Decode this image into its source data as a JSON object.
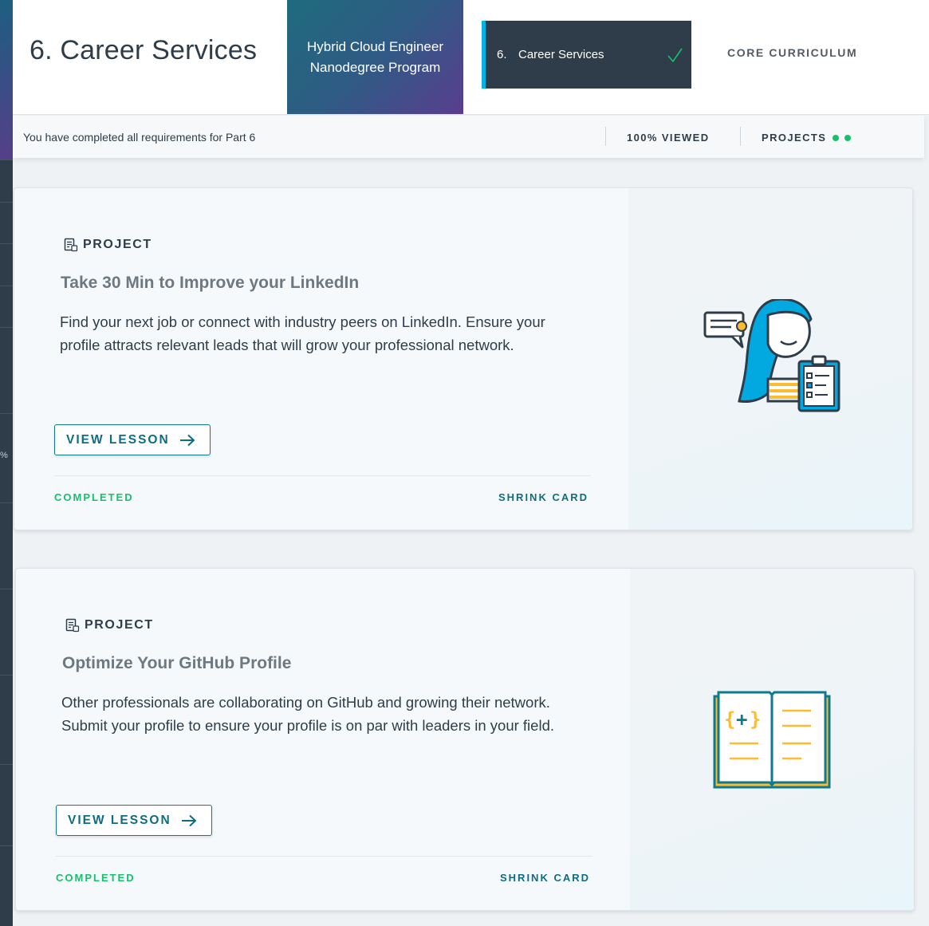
{
  "header": {
    "page_title": "6. Career Services",
    "program_name": "Hybrid Cloud Engineer Nanodegree Program",
    "current_part": {
      "number": "6.",
      "label": "Career Services",
      "completed": true
    },
    "core_curriculum_label": "CORE CURRICULUM"
  },
  "status": {
    "message": "You have completed all requirements for Part 6",
    "viewed": "100% VIEWED",
    "projects_label": "PROJECTS",
    "projects_dots": 2
  },
  "sidebar": {
    "partial_text": "%"
  },
  "cards": [
    {
      "kind": "PROJECT",
      "title": "Take 30 Min to Improve your LinkedIn",
      "description": "Find your next job or connect with industry peers on LinkedIn. Ensure your profile attracts relevant leads that will grow your professional network.",
      "button_label": "VIEW LESSON",
      "status": "COMPLETED",
      "toggle_label": "SHRINK CARD",
      "illustration": "person-with-clipboard-illustration"
    },
    {
      "kind": "PROJECT",
      "title": "Optimize Your GitHub Profile",
      "description": "Other professionals are collaborating on GitHub and growing their network. Submit your profile to ensure your profile is on par with leaders in your field.",
      "button_label": "VIEW LESSON",
      "status": "COMPLETED",
      "toggle_label": "SHRINK CARD",
      "illustration": "code-book-illustration"
    }
  ],
  "colors": {
    "dark_navy": "#2e3d49",
    "accent_blue": "#02b3e4",
    "success_green": "#15c26b",
    "teal_link": "#0e6d82"
  }
}
